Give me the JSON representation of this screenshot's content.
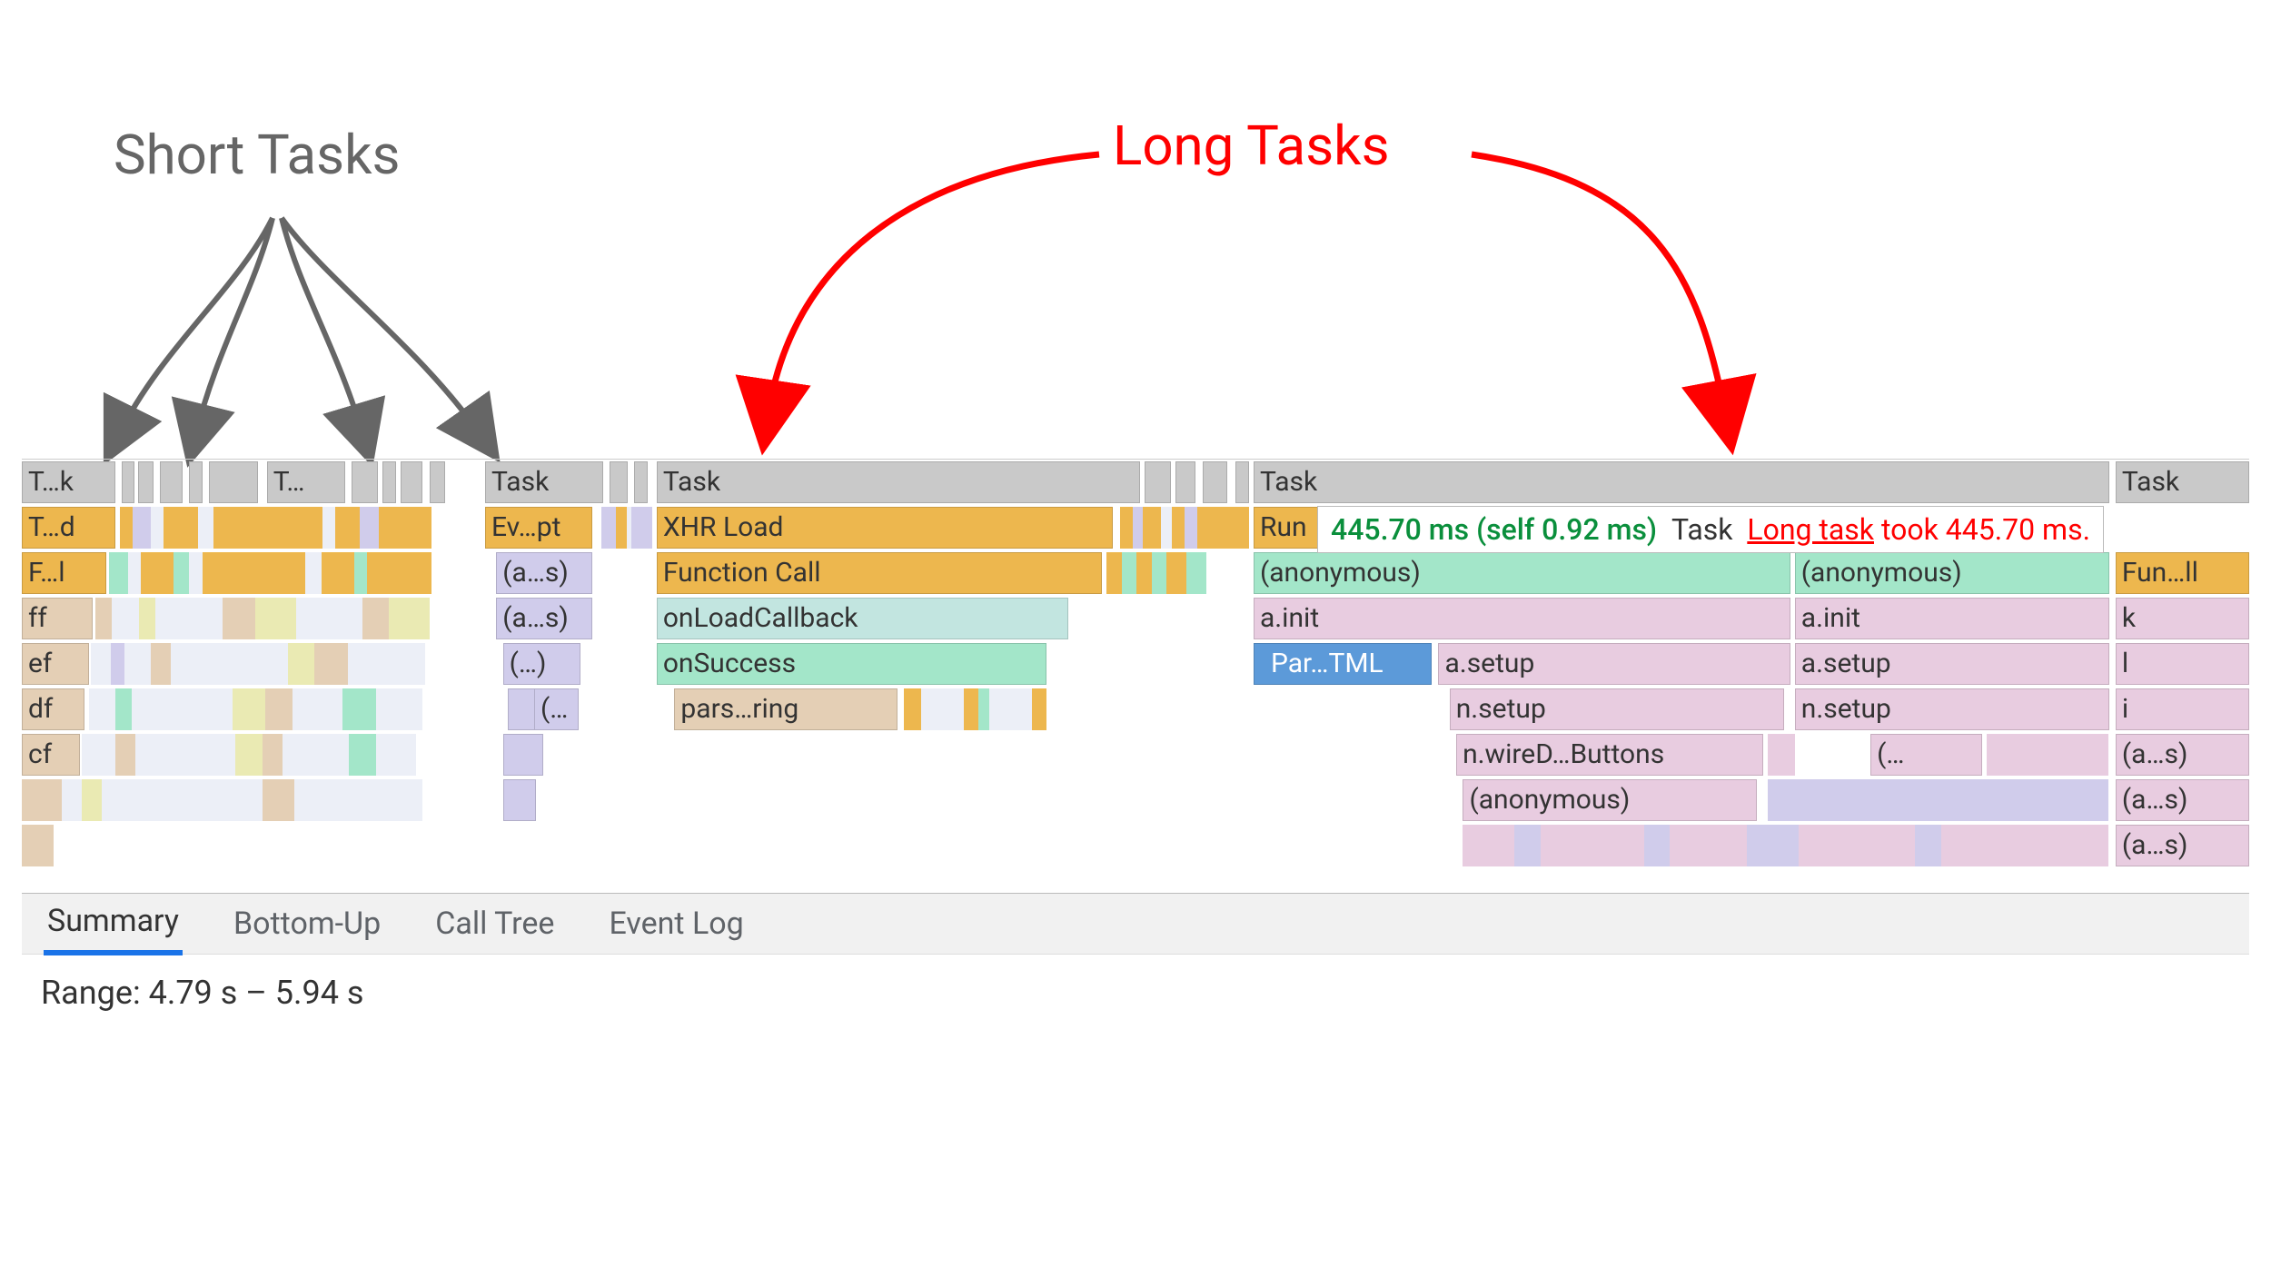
{
  "annotations": {
    "short_tasks": "Short Tasks",
    "long_tasks": "Long Tasks"
  },
  "flame": {
    "row0": {
      "task_a": "T…k",
      "task_b": "T…",
      "task_c": "Task",
      "task_d": "Task",
      "task_e": "Task",
      "task_f": "Task"
    },
    "row1": {
      "a": "T…d",
      "b": "Ev…pt",
      "c": "XHR Load",
      "d": "Run"
    },
    "row2": {
      "a": "F…l",
      "b": "(a…s)",
      "c": "Function Call",
      "d": "(anonymous)",
      "e": "(anonymous)",
      "f": "Fun…ll"
    },
    "row3": {
      "a": "ff",
      "b": "(a…s)",
      "c": "onLoadCallback",
      "d": "a.init",
      "e": "a.init",
      "f": "k"
    },
    "row4": {
      "a": "ef",
      "b": "(…)",
      "c": "onSuccess",
      "d": "Par…TML",
      "e": "a.setup",
      "f": "a.setup",
      "g": "l"
    },
    "row5": {
      "a": "df",
      "b": "(…",
      "c": "pars…ring",
      "d": "n.setup",
      "e": "n.setup",
      "f": "i"
    },
    "row6": {
      "a": "cf",
      "b": "n.wireD…Buttons",
      "c": "(…",
      "d": "(a…s)"
    },
    "row7": {
      "a": "(anonymous)",
      "b": "(a…s)"
    },
    "row8": {
      "a": "(a…s)"
    }
  },
  "tooltip": {
    "duration": "445.70 ms (self 0.92 ms)",
    "name": "Task",
    "long_link": "Long task",
    "long_text": " took 445.70 ms."
  },
  "tabs": {
    "summary": "Summary",
    "bottom_up": "Bottom-Up",
    "call_tree": "Call Tree",
    "event_log": "Event Log"
  },
  "range_label": "Range: 4.79 s – 5.94 s"
}
